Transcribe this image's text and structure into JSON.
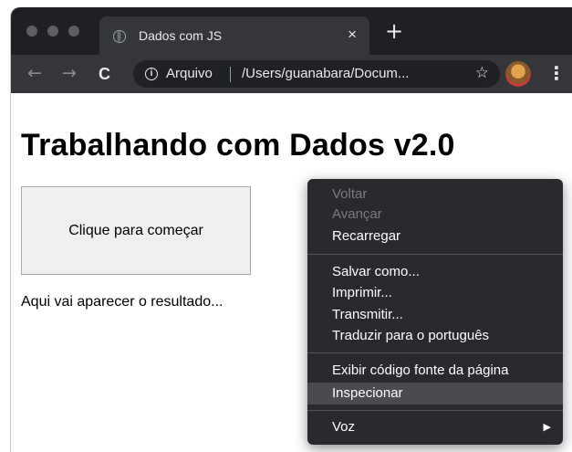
{
  "browser": {
    "tab": {
      "title": "Dados com JS",
      "close_glyph": "×",
      "favicon_icon": "globe-icon"
    },
    "new_tab_glyph": "+",
    "toolbar": {
      "back_glyph": "←",
      "forward_glyph": "→",
      "reload_glyph": "C",
      "info_glyph": "i",
      "origin_chip": "Arquivo",
      "url": "/Users/guanabara/Docum...",
      "star_glyph": "☆",
      "menu_glyph": "⋮"
    },
    "colors": {
      "titlebar": "#1f2023",
      "toolbar": "#35363a",
      "omnibox": "#202124",
      "menu_background": "#292a2d",
      "menu_highlight": "#4a4b4f",
      "disabled_text": "#7b7c80"
    }
  },
  "page": {
    "title": "Trabalhando com Dados v2.0",
    "button_label": "Clique para começar",
    "result_text": "Aqui vai aparecer o resultado..."
  },
  "context_menu": {
    "items": [
      {
        "label": "Voltar",
        "disabled": true
      },
      {
        "label": "Avançar",
        "disabled": true
      },
      {
        "label": "Recarregar",
        "disabled": false
      },
      {
        "label": "Salvar como...",
        "disabled": false
      },
      {
        "label": "Imprimir...",
        "disabled": false
      },
      {
        "label": "Transmitir...",
        "disabled": false
      },
      {
        "label": "Traduzir para o português",
        "disabled": false
      },
      {
        "label": "Exibir código fonte da página",
        "disabled": false
      },
      {
        "label": "Inspecionar",
        "disabled": false,
        "highlighted": true
      },
      {
        "label": "Voz",
        "disabled": false,
        "submenu_glyph": "▶"
      }
    ]
  }
}
